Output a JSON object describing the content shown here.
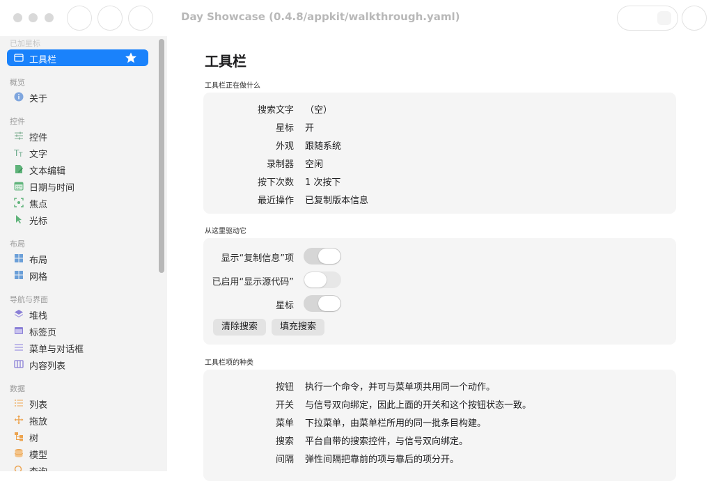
{
  "window": {
    "title": "Day Showcase (0.4.8/appkit/walkthrough.yaml)"
  },
  "sidebar": {
    "sections": [
      {
        "id": "bookmarked",
        "label": "已加星标"
      },
      {
        "id": "overview",
        "label": "概览"
      },
      {
        "id": "controls",
        "label": "控件"
      },
      {
        "id": "layout",
        "label": "布局"
      },
      {
        "id": "navigation",
        "label": "导航与界面"
      },
      {
        "id": "data",
        "label": "数据"
      }
    ],
    "items": [
      {
        "label": "工具栏",
        "icon": "window-icon",
        "selected": true,
        "starred": true
      },
      {
        "label": "关于",
        "icon": "info-icon"
      },
      {
        "label": "控件",
        "icon": "sliders-icon"
      },
      {
        "label": "文字",
        "icon": "text-icon"
      },
      {
        "label": "文本编辑",
        "icon": "edit-icon"
      },
      {
        "label": "日期与时间",
        "icon": "calendar-icon"
      },
      {
        "label": "焦点",
        "icon": "focus-icon"
      },
      {
        "label": "光标",
        "icon": "cursor-icon"
      },
      {
        "label": "布局",
        "icon": "layout-grid-icon"
      },
      {
        "label": "网格",
        "icon": "grid-icon"
      },
      {
        "label": "堆栈",
        "icon": "stack-icon"
      },
      {
        "label": "标签页",
        "icon": "tabs-icon"
      },
      {
        "label": "菜单与对话框",
        "icon": "menu-icon"
      },
      {
        "label": "内容列表",
        "icon": "columns-icon"
      },
      {
        "label": "列表",
        "icon": "list-icon"
      },
      {
        "label": "拖放",
        "icon": "drag-icon"
      },
      {
        "label": "树",
        "icon": "tree-icon"
      },
      {
        "label": "模型",
        "icon": "database-icon"
      },
      {
        "label": "查询",
        "icon": "query-icon"
      }
    ]
  },
  "main": {
    "title": "工具栏",
    "status_group": {
      "header": "工具栏正在做什么",
      "rows": [
        {
          "key": "搜索文字",
          "value": "（空）"
        },
        {
          "key": "星标",
          "value": "开"
        },
        {
          "key": "外观",
          "value": "跟随系统"
        },
        {
          "key": "录制器",
          "value": "空闲"
        },
        {
          "key": "按下次数",
          "value": "1 次按下"
        },
        {
          "key": "最近操作",
          "value": "已复制版本信息"
        }
      ]
    },
    "drive_group": {
      "header": "从这里驱动它",
      "toggles": [
        {
          "label": "显示“复制信息”项",
          "on": true
        },
        {
          "label": "已启用“显示源代码”",
          "on": false
        },
        {
          "label": "星标",
          "on": true
        }
      ],
      "buttons": [
        "清除搜索",
        "填充搜索"
      ]
    },
    "kinds_group": {
      "header": "工具栏项的种类",
      "rows": [
        {
          "key": "按钮",
          "value": "执行一个命令，并可与菜单项共用同一个动作。"
        },
        {
          "key": "开关",
          "value": "与信号双向绑定，因此上面的开关和这个按钮状态一致。"
        },
        {
          "key": "菜单",
          "value": "下拉菜单，由菜单栏所用的同一批条目构建。"
        },
        {
          "key": "搜索",
          "value": "平台自带的搜索控件，与信号双向绑定。"
        },
        {
          "key": "间隔",
          "value": "弹性间隔把靠前的项与靠后的项分开。"
        }
      ]
    }
  },
  "colors": {
    "accent": "#1a82fb",
    "sidebar_bg": "#f3f3f3",
    "card_bg": "#f5f5f5",
    "icon_blue": "#5b9bd5",
    "icon_green": "#5fb37a",
    "icon_orange": "#eca34e",
    "icon_purple": "#8a7fd6"
  }
}
